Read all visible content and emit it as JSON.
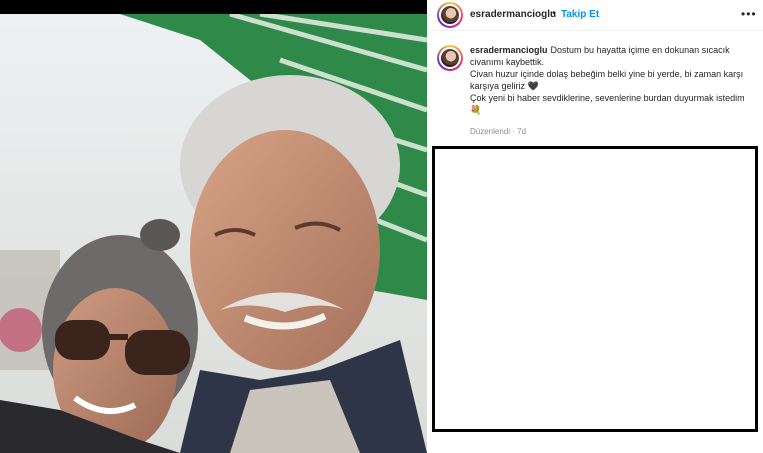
{
  "post": {
    "username": "esradermancioglu",
    "separator": "•",
    "follow_label": "Takip Et",
    "more_label": "•••"
  },
  "caption": {
    "username": "esradermancioglu",
    "line1": "Dostum bu hayatta içime en dokunan sıcacık civanımı kaybettik.",
    "line2": "Civan huzur içinde dolaş bebeğim belki yine bi yerde, bi zaman karşı karşıya geliriz",
    "line2_emoji": "🖤",
    "line3": "Çok yeni bi haber sevdiklerine, sevenlerine burdan duyurmak istedim",
    "line3_emoji": "💐",
    "edited": "Düzenlendi · 7d"
  },
  "colors": {
    "accent": "#0095f6",
    "muted": "#8e8e8e",
    "text": "#262626",
    "awning_green": "#2f8a4a"
  },
  "icons": {
    "more": "more-options-icon",
    "avatar": "profile-avatar"
  }
}
